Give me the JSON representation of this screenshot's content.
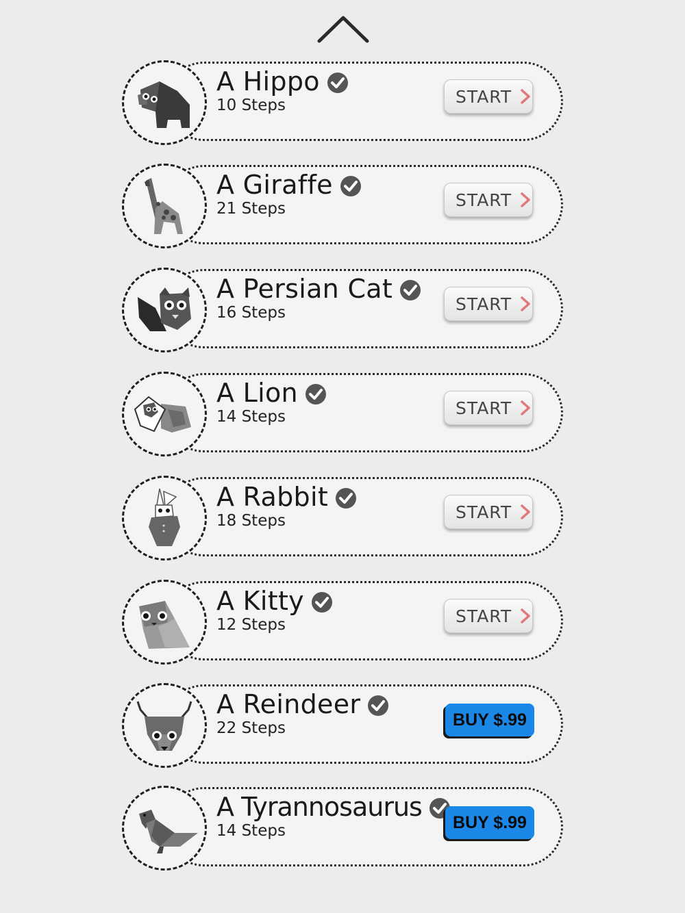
{
  "header": {
    "collapse_icon": "chevron-up-icon"
  },
  "items": [
    {
      "title": "A Hippo",
      "steps": "10 Steps",
      "action": "START",
      "icon": "hippo-icon",
      "completed": true
    },
    {
      "title": "A Giraffe",
      "steps": "21 Steps",
      "action": "START",
      "icon": "giraffe-icon",
      "completed": true
    },
    {
      "title": "A Persian Cat",
      "steps": "16 Steps",
      "action": "START",
      "icon": "persian-cat-icon",
      "completed": true
    },
    {
      "title": "A Lion",
      "steps": "14 Steps",
      "action": "START",
      "icon": "lion-icon",
      "completed": true
    },
    {
      "title": "A Rabbit",
      "steps": "18 Steps",
      "action": "START",
      "icon": "rabbit-icon",
      "completed": true
    },
    {
      "title": "A Kitty",
      "steps": "12 Steps",
      "action": "START",
      "icon": "kitty-icon",
      "completed": true
    },
    {
      "title": "A Reindeer",
      "steps": "22 Steps",
      "action": "BUY $.99",
      "icon": "reindeer-icon",
      "completed": true
    },
    {
      "title": "A Tyrannosaurus",
      "steps": "14 Steps",
      "action": "BUY $.99",
      "icon": "tyrannosaurus-icon",
      "completed": true
    }
  ],
  "colors": {
    "buy_button": "#1b87e6",
    "chevron_accent": "#e0777b",
    "check_badge": "#555555"
  }
}
